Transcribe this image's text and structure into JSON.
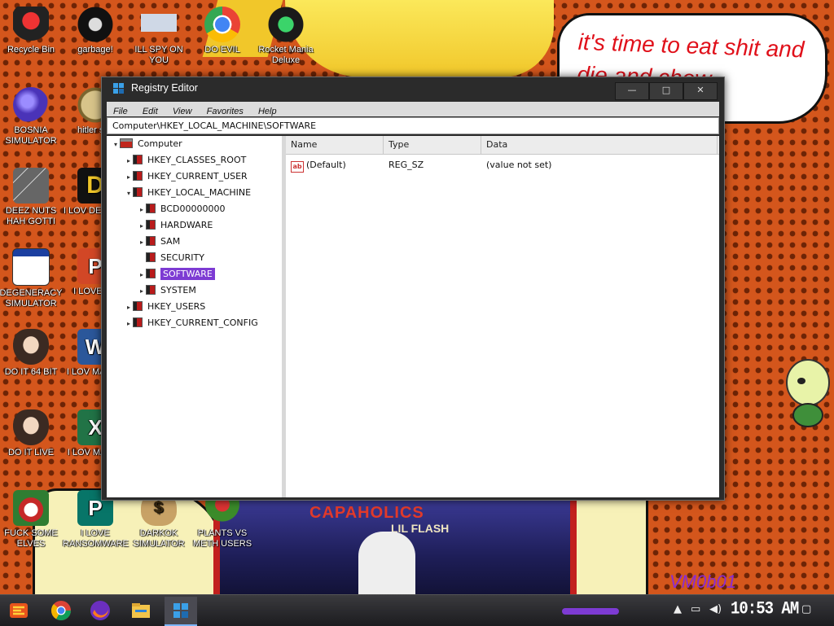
{
  "wallpaper": {
    "bubble_text": "it's time to eat shit and die and chew",
    "bubble_tail": "w",
    "album_title": "CAPAHOLICS",
    "album_subtitle": "LIL FLASH",
    "signature": "VM0b01"
  },
  "desktop_icons": [
    {
      "label": "Recycle Bin",
      "icon": "recycle-bin-icon"
    },
    {
      "label": "garbage!",
      "icon": "garbage-icon"
    },
    {
      "label": "ILL SPY ON YOU",
      "icon": "spy-icon"
    },
    {
      "label": "DO EVIL",
      "icon": "chrome-icon"
    },
    {
      "label": "Rocket Mania Deluxe",
      "icon": "rocket-icon"
    },
    {
      "label": "BOSNIA SIMULATOR",
      "icon": "mine-icon"
    },
    {
      "label": "hitler sim",
      "icon": "coin-icon"
    },
    {
      "label": "DEEZ NUTS HAH GOTTI",
      "icon": "windows-stack-icon"
    },
    {
      "label": "I LOV DETECTI",
      "icon": "d-app-icon"
    },
    {
      "label": "DEGENERACY SIMULATOR",
      "icon": "window-app-icon"
    },
    {
      "label": "I LOVE EN",
      "icon": "powerpoint-icon"
    },
    {
      "label": "DO IT 64 BIT",
      "icon": "portrait-64-icon"
    },
    {
      "label": "I LOV MALDO",
      "icon": "word-icon"
    },
    {
      "label": "DO IT LIVE",
      "icon": "portrait-icon"
    },
    {
      "label": "I LOV MALSP",
      "icon": "excel-icon"
    },
    {
      "label": "FUCK SOME ELVES",
      "icon": "elf-icon"
    },
    {
      "label": "I LOVE RANSOMWARE",
      "icon": "publisher-icon"
    },
    {
      "label": "DARKOK SIMULATOR",
      "icon": "money-bag-icon"
    },
    {
      "label": "PLANTS VS METH USERS",
      "icon": "plant-icon"
    }
  ],
  "window": {
    "title": "Registry Editor",
    "controls": {
      "minimize": "—",
      "maximize": "□",
      "close": "✕"
    },
    "menu": [
      "File",
      "Edit",
      "View",
      "Favorites",
      "Help"
    ],
    "address": "Computer\\HKEY_LOCAL_MACHINE\\SOFTWARE",
    "tree": [
      {
        "label": "Computer",
        "level": 0,
        "arrow": "▾",
        "selected": false
      },
      {
        "label": "HKEY_CLASSES_ROOT",
        "level": 1,
        "arrow": "▸",
        "selected": false
      },
      {
        "label": "HKEY_CURRENT_USER",
        "level": 1,
        "arrow": "▸",
        "selected": false
      },
      {
        "label": "HKEY_LOCAL_MACHINE",
        "level": 1,
        "arrow": "▾",
        "selected": false
      },
      {
        "label": "BCD00000000",
        "level": 2,
        "arrow": "▸",
        "selected": false
      },
      {
        "label": "HARDWARE",
        "level": 2,
        "arrow": "▸",
        "selected": false
      },
      {
        "label": "SAM",
        "level": 2,
        "arrow": "▸",
        "selected": false
      },
      {
        "label": "SECURITY",
        "level": 2,
        "arrow": "",
        "selected": false
      },
      {
        "label": "SOFTWARE",
        "level": 2,
        "arrow": "▸",
        "selected": true
      },
      {
        "label": "SYSTEM",
        "level": 2,
        "arrow": "▸",
        "selected": false
      },
      {
        "label": "HKEY_USERS",
        "level": 1,
        "arrow": "▸",
        "selected": false
      },
      {
        "label": "HKEY_CURRENT_CONFIG",
        "level": 1,
        "arrow": "▸",
        "selected": false
      }
    ],
    "columns": [
      "Name",
      "Type",
      "Data"
    ],
    "values": [
      {
        "icon": "ab",
        "name": "(Default)",
        "type": "REG_SZ",
        "data": "(value not set)"
      }
    ]
  },
  "taskbar": {
    "clock": "10:53 AM",
    "tray_icons": [
      "chevron-up-icon",
      "network-icon",
      "volume-icon",
      "notification-icon"
    ]
  }
}
